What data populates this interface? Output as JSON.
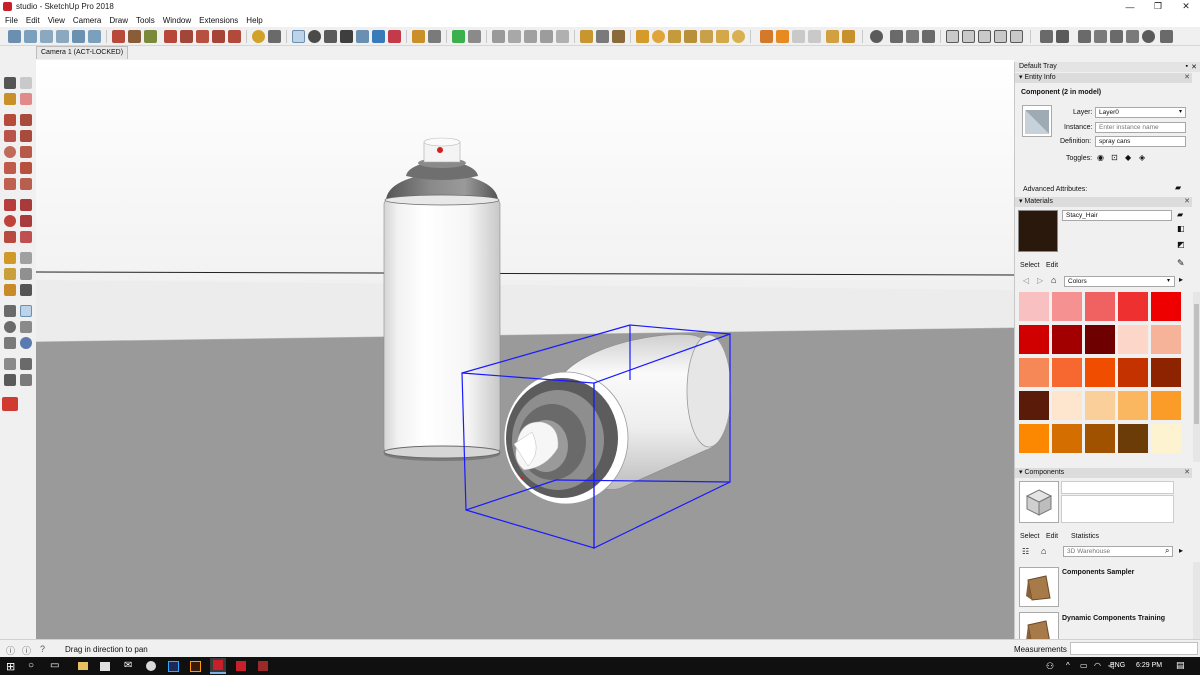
{
  "window": {
    "title": "studio - SketchUp Pro 2018",
    "minimize": "—",
    "maximize": "❐",
    "close": "✕"
  },
  "menu": [
    "File",
    "Edit",
    "View",
    "Camera",
    "Draw",
    "Tools",
    "Window",
    "Extensions",
    "Help"
  ],
  "scene_tab": "Camera 1 (ACT-LOCKED)",
  "tray": {
    "title": "Default Tray",
    "entity_info": {
      "title": "Entity Info",
      "heading": "Component (2 in model)",
      "layer_label": "Layer:",
      "layer_value": "Layer0",
      "instance_label": "Instance:",
      "instance_placeholder": "Enter instance name",
      "definition_label": "Definition:",
      "definition_value": "spray cans",
      "toggles_label": "Toggles:",
      "advanced": "Advanced Attributes:"
    },
    "materials": {
      "title": "Materials",
      "material_name": "Stacy_Hair",
      "current_color": "#2a180c",
      "tab_select": "Select",
      "tab_edit": "Edit",
      "library": "Colors",
      "swatches": [
        "#f8c0c0",
        "#f59191",
        "#f06262",
        "#ee3030",
        "#ee0000",
        "#d00000",
        "#a20000",
        "#6e0000",
        "#fbd6c9",
        "#f7b29a",
        "#f68858",
        "#f66830",
        "#f14d00",
        "#c43200",
        "#8e2300",
        "#5a1c08",
        "#fde6cd",
        "#fbcf9a",
        "#fbb660",
        "#fb9b28",
        "#fb8800",
        "#d56e00",
        "#a05200",
        "#6b3c08",
        "#fdf3d1"
      ]
    },
    "components": {
      "title": "Components",
      "tab_select": "Select",
      "tab_edit": "Edit",
      "tab_statistics": "Statistics",
      "search_placeholder": "3D Warehouse",
      "items": [
        "Components Sampler",
        "Dynamic Components Training"
      ]
    }
  },
  "status": {
    "message": "Drag in direction to pan",
    "measurements_label": "Measurements"
  },
  "taskbar": {
    "language": "ENG",
    "time": "6:29 PM"
  },
  "colors": {
    "accent": "#c8202a",
    "selection_box": "#1a1aff",
    "wall": "#f4f4f4",
    "floor": "#9a9a9a"
  }
}
